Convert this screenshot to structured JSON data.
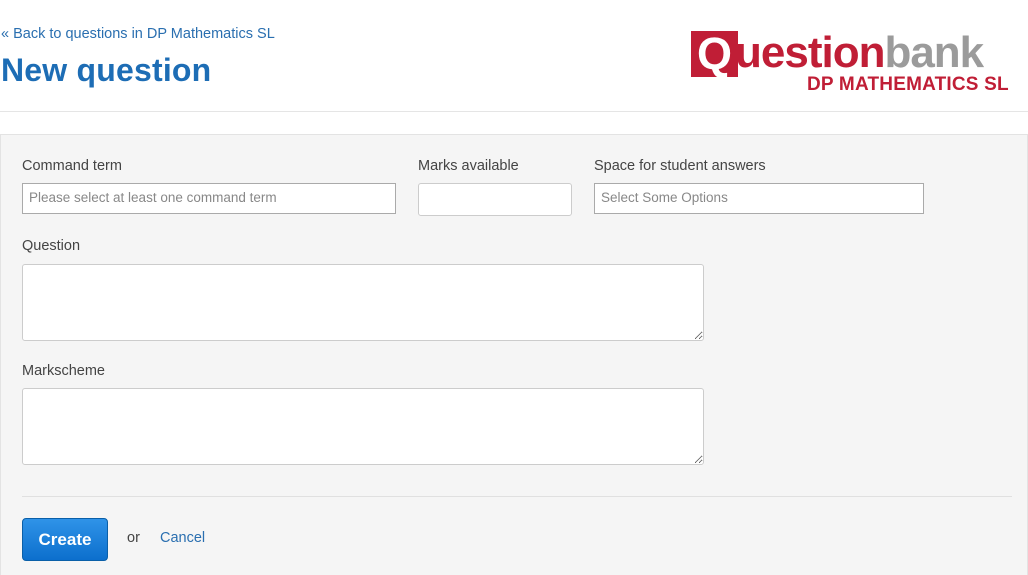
{
  "header": {
    "back_link": "« Back to questions in DP Mathematics SL",
    "title": "New question"
  },
  "logo": {
    "q_letter": "Q",
    "word_question": "uestion",
    "word_bank": "bank",
    "subtitle": "DP MATHEMATICS SL",
    "brand_red": "#c01e36",
    "brand_grey": "#9b9b9b"
  },
  "form": {
    "command_term": {
      "label": "Command term",
      "placeholder": "Please select at least one command term"
    },
    "marks_available": {
      "label": "Marks available",
      "value": ""
    },
    "space_for_answers": {
      "label": "Space for student answers",
      "placeholder": "Select Some Options"
    },
    "question": {
      "label": "Question",
      "value": ""
    },
    "markscheme": {
      "label": "Markscheme",
      "value": ""
    }
  },
  "actions": {
    "create_label": "Create",
    "or_text": "or",
    "cancel_label": "Cancel",
    "primary_color": "#0c6fcd"
  }
}
